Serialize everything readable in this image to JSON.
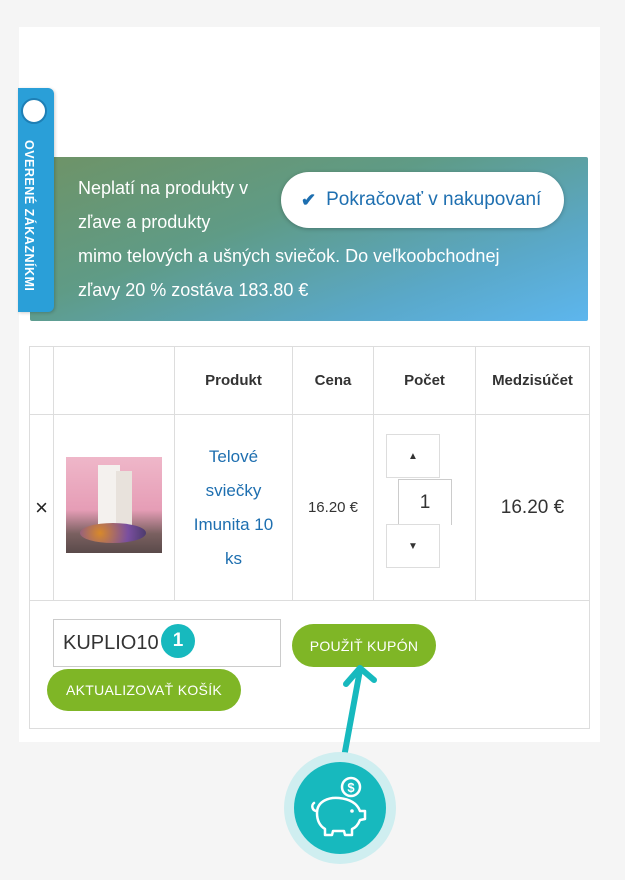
{
  "badge": {
    "text": "OVERENÉ ZÁKAZNÍKMI"
  },
  "banner": {
    "line1": "Neplatí na produkty v",
    "line2": "zľave a produkty",
    "line3": "mimo telových a ušných sviečok. Do veľkoobchodnej",
    "line4": "zľavy 20 % zostáva 183.80 €",
    "continue_button": "Pokračovať v nakupovaní"
  },
  "table": {
    "headers": [
      "",
      "",
      "Produkt",
      "Cena",
      "Počet",
      "Medzisúčet"
    ],
    "rows": [
      {
        "remove": "×",
        "product_name": "Telové sviečky Imunita 10 ks",
        "price": "16.20 €",
        "quantity": "1",
        "subtotal": "16.20 €"
      }
    ]
  },
  "coupon": {
    "code": "KUPLIO10",
    "step_number": "1",
    "apply_button": "POUŽIŤ KUPÓN",
    "update_button": "AKTUALIZOVAŤ KOŠÍK"
  },
  "colors": {
    "accent_blue": "#1e6fb0",
    "button_green": "#7fb626",
    "teal": "#17b9be"
  },
  "icons": [
    "check-icon",
    "chevron-up-icon",
    "chevron-down-icon",
    "close-icon",
    "piggy-bank-icon",
    "arrow-icon",
    "verified-seal-icon"
  ]
}
